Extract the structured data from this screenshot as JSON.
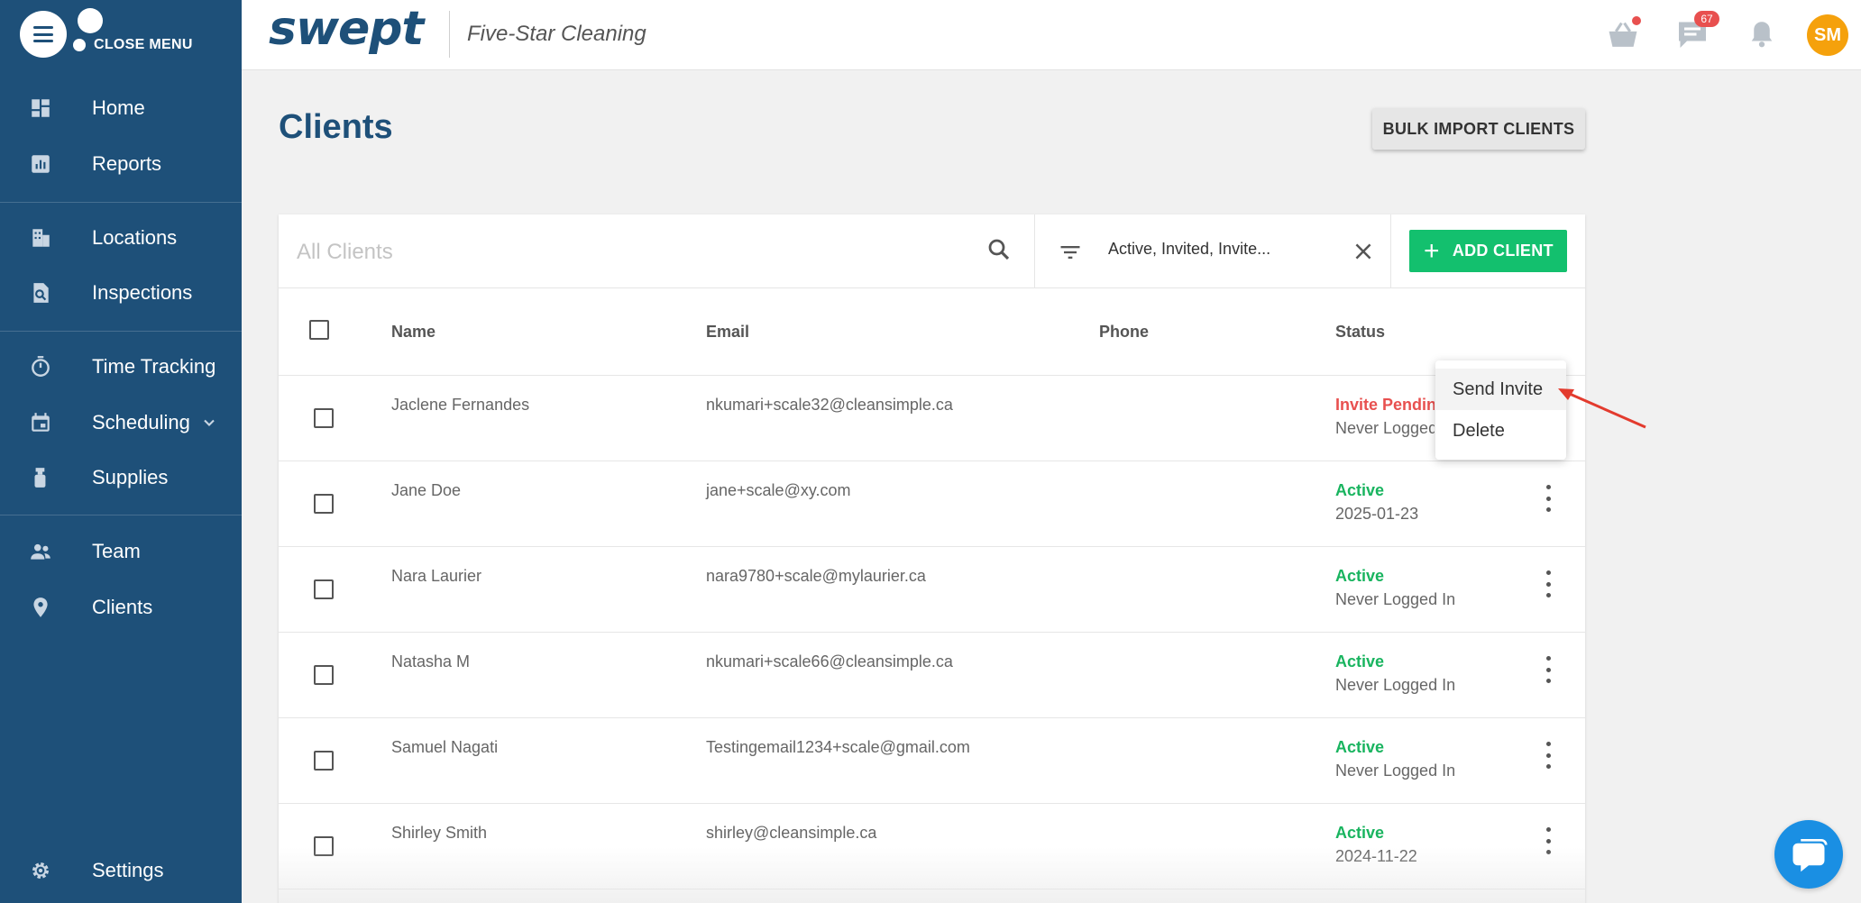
{
  "sidebar": {
    "close_menu_label": "CLOSE MENU",
    "items": [
      {
        "label": "Home"
      },
      {
        "label": "Reports"
      },
      {
        "label": "Locations"
      },
      {
        "label": "Inspections"
      },
      {
        "label": "Time Tracking"
      },
      {
        "label": "Scheduling"
      },
      {
        "label": "Supplies"
      },
      {
        "label": "Team"
      },
      {
        "label": "Clients"
      },
      {
        "label": "Settings"
      }
    ]
  },
  "header": {
    "logo": "swept",
    "company": "Five-Star Cleaning",
    "messages_count": "67",
    "avatar_initials": "SM"
  },
  "page": {
    "title": "Clients",
    "bulk_import_label": "BULK IMPORT CLIENTS"
  },
  "toolbar": {
    "search_placeholder": "All Clients",
    "filter_text": "Active, Invited, Invite...",
    "add_client_label": "ADD CLIENT"
  },
  "table": {
    "columns": [
      "Name",
      "Email",
      "Phone",
      "Status"
    ],
    "rows": [
      {
        "name": "Jaclene Fernandes",
        "email": "nkumari+scale32@cleansimple.ca",
        "phone": "",
        "status": "Invite Pending",
        "status_sub": "Never Logged In"
      },
      {
        "name": "Jane Doe",
        "email": "jane+scale@xy.com",
        "phone": "",
        "status": "Active",
        "status_sub": "2025-01-23"
      },
      {
        "name": "Nara Laurier",
        "email": "nara9780+scale@mylaurier.ca",
        "phone": "",
        "status": "Active",
        "status_sub": "Never Logged In"
      },
      {
        "name": "Natasha M",
        "email": "nkumari+scale66@cleansimple.ca",
        "phone": "",
        "status": "Active",
        "status_sub": "Never Logged In"
      },
      {
        "name": "Samuel Nagati",
        "email": "Testingemail1234+scale@gmail.com",
        "phone": "",
        "status": "Active",
        "status_sub": "Never Logged In"
      },
      {
        "name": "Shirley Smith",
        "email": "shirley@cleansimple.ca",
        "phone": "",
        "status": "Active",
        "status_sub": "2024-11-22"
      }
    ]
  },
  "context_menu": {
    "items": [
      "Send Invite",
      "Delete"
    ]
  },
  "colors": {
    "sidebar": "#1e5079",
    "accent_green": "#13c06e",
    "status_active": "#19b45f",
    "status_pending": "#e8504f",
    "avatar": "#f5a10c",
    "chat": "#1a8fe3"
  },
  "icons": [
    "menu-icon",
    "home-icon",
    "reports-icon",
    "locations-icon",
    "inspections-icon",
    "timer-icon",
    "calendar-icon",
    "supplies-icon",
    "team-icon",
    "pin-icon",
    "gear-icon",
    "basket-icon",
    "chat-icon",
    "bell-icon",
    "search-icon",
    "filter-icon",
    "close-icon",
    "plus-icon",
    "kebab-icon",
    "arrow-annotation"
  ]
}
